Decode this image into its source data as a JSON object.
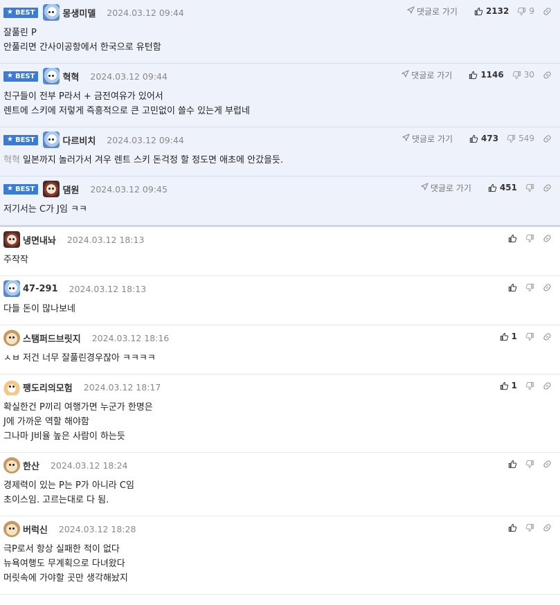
{
  "best_label": "BEST",
  "reply_label": "댓글로 가기",
  "best_comments": [
    {
      "nick": "몽생미델",
      "date": "2024.03.12 09:44",
      "likes": "2132",
      "dislikes": "9",
      "avatar": "blue",
      "lines": [
        "잘풀린 P",
        "안풀리면 간사이공항에서 한국으로 유턴함"
      ]
    },
    {
      "nick": "혁혁",
      "date": "2024.03.12 09:44",
      "likes": "1146",
      "dislikes": "30",
      "avatar": "blue",
      "lines": [
        "친구들이 전부 P라서 + 금전여유가 있어서",
        "렌트에 스키에 저렇게 즉흥적으로 큰 고민없이 쓸수 있는게 부럽네"
      ]
    },
    {
      "nick": "다르비치",
      "date": "2024.03.12 09:44",
      "likes": "473",
      "dislikes": "549",
      "avatar": "blue",
      "mention": "혁혁",
      "lines": [
        "일본까지 놀러가서 겨우 렌트 스키 돈걱정 할 정도면 애초에 안갔을듯."
      ]
    },
    {
      "nick": "댐원",
      "date": "2024.03.12 09:45",
      "likes": "451",
      "dislikes": "",
      "avatar": "dog",
      "lines": [
        "저기서는 C가 J임 ㅋㅋ"
      ]
    }
  ],
  "comments": [
    {
      "nick": "냉면내놔",
      "date": "2024.03.12 18:13",
      "likes": "",
      "avatar": "dog",
      "lines": [
        "주작작"
      ]
    },
    {
      "nick": "47-291",
      "date": "2024.03.12 18:13",
      "likes": "",
      "avatar": "blue",
      "lines": [
        "다들 돈이 많나보네"
      ]
    },
    {
      "nick": "스탬퍼드브릿지",
      "date": "2024.03.12 18:16",
      "likes": "1",
      "avatar": "puppy",
      "lines": [
        "ㅅㅂ 저건 너무 잘풀린경우잖아 ㅋㅋㅋㅋ"
      ]
    },
    {
      "nick": "팽도리의모험",
      "date": "2024.03.12 18:17",
      "likes": "1",
      "avatar": "fox",
      "lines": [
        "확실한건 P끼리 여행가면 누군가 한명은",
        "J에 가까운 역할 해야함",
        "그나마 J비율 높은 사람이 하는듯"
      ]
    },
    {
      "nick": "한산",
      "date": "2024.03.12 18:24",
      "likes": "",
      "avatar": "puppy",
      "lines": [
        "경제력이 있는 P는 P가 아니라 C임",
        "초이스임. 고르는대로 다 됨."
      ]
    },
    {
      "nick": "버럭신",
      "date": "2024.03.12 18:28",
      "likes": "",
      "avatar": "puppy",
      "lines": [
        "극P로서 항상 실패한 적이 없다",
        "뉴욕여행도 무계획으로 다녀왔다",
        "머릿속에 가야할 곳만 생각해놨지"
      ]
    }
  ],
  "icons": {
    "reply": "send-arrow-icon",
    "like": "thumbs-up-icon",
    "dislike": "thumbs-down-icon",
    "link": "link-icon"
  },
  "colors": {
    "best_badge": "#3a7bd5",
    "best_background": "#eef3fb",
    "mention": "#999999"
  }
}
